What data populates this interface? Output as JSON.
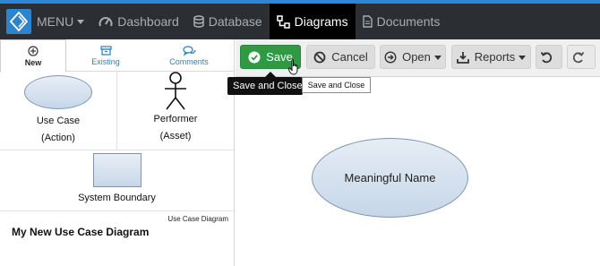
{
  "nav": {
    "menu": "MENU",
    "items": [
      {
        "label": "Dashboard",
        "icon": "dashboard-icon"
      },
      {
        "label": "Database",
        "icon": "database-icon"
      },
      {
        "label": "Diagrams",
        "icon": "diagrams-icon",
        "active": true
      },
      {
        "label": "Documents",
        "icon": "document-icon"
      }
    ],
    "colors": {
      "bar": "#2b2f33",
      "accent": "#2f86d8",
      "active": "#000000"
    }
  },
  "left_panel": {
    "tabs": [
      {
        "label": "New",
        "icon": "plus-circle-icon",
        "active": true
      },
      {
        "label": "Existing",
        "icon": "archive-icon"
      },
      {
        "label": "Comments",
        "icon": "comments-icon"
      }
    ],
    "shapes": [
      {
        "line1": "Use Case",
        "line2": "(Action)"
      },
      {
        "line1": "Performer",
        "line2": "(Asset)"
      }
    ],
    "boundary": {
      "label": "System Boundary"
    },
    "diagram": {
      "type": "Use Case Diagram",
      "name": "My New Use Case Diagram"
    }
  },
  "toolbar": {
    "save": "Save",
    "cancel": "Cancel",
    "open": "Open",
    "reports": "Reports",
    "save_color": "#2f9a43"
  },
  "tooltips": {
    "dark": "Save and Close",
    "light": "Save and Close"
  },
  "canvas": {
    "element_label": "Meaningful Name"
  }
}
